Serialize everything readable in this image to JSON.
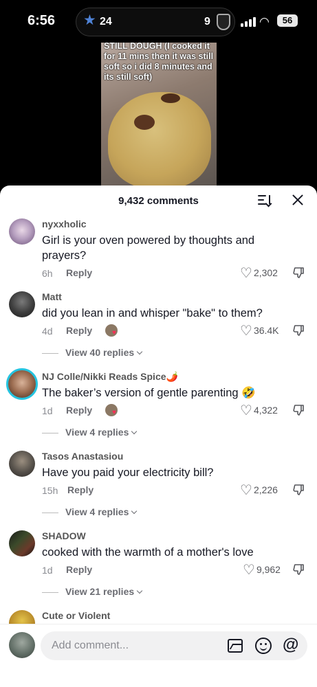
{
  "status_bar": {
    "time": "6:56",
    "score_left": "24",
    "score_right": "9",
    "battery": "56",
    "team_left_icon": "star-icon",
    "team_right_icon": "shield-icon"
  },
  "video": {
    "caption": "STILL DOUGH (I cooked it for 11 mins then it was still soft so i did 8 minutes and its still soft)"
  },
  "comments_panel": {
    "title": "9,432 comments",
    "sort_icon": "sort-icon",
    "close_icon": "close-icon"
  },
  "comments": [
    {
      "username": "nyxxholic",
      "text": "Girl is your oven powered by thoughts and prayers?",
      "time": "6h",
      "reply_label": "Reply",
      "likes": "2,302",
      "creator_liked": false,
      "view_replies": ""
    },
    {
      "username": "Matt",
      "text": "did you lean in and whisper \"bake\" to them?",
      "time": "4d",
      "reply_label": "Reply",
      "likes": "36.4K",
      "creator_liked": true,
      "view_replies": "View 40 replies"
    },
    {
      "username": "NJ Colle/Nikki Reads Spice🌶️",
      "text": "The baker’s version of gentle parenting 🤣",
      "time": "1d",
      "reply_label": "Reply",
      "likes": "4,322",
      "creator_liked": true,
      "view_replies": "View 4 replies"
    },
    {
      "username": "Tasos Anastasiou",
      "text": "Have you paid your electricity bill?",
      "time": "15h",
      "reply_label": "Reply",
      "likes": "2,226",
      "creator_liked": false,
      "view_replies": "View 4 replies"
    },
    {
      "username": "SHADOW",
      "text": "cooked with the warmth of a mother's love",
      "time": "1d",
      "reply_label": "Reply",
      "likes": "9,962",
      "creator_liked": false,
      "view_replies": "View 21 replies"
    },
    {
      "username": "Cute or Violent",
      "text": "",
      "time": "",
      "reply_label": "",
      "likes": "",
      "creator_liked": false,
      "view_replies": ""
    }
  ],
  "composer": {
    "placeholder": "Add comment...",
    "image_icon": "image-icon",
    "emoji_icon": "emoji-icon",
    "mention_icon": "at-icon"
  },
  "colors": {
    "like_heart": "#fe2c55",
    "text_primary": "#161823",
    "text_secondary": "#8a8b91"
  }
}
